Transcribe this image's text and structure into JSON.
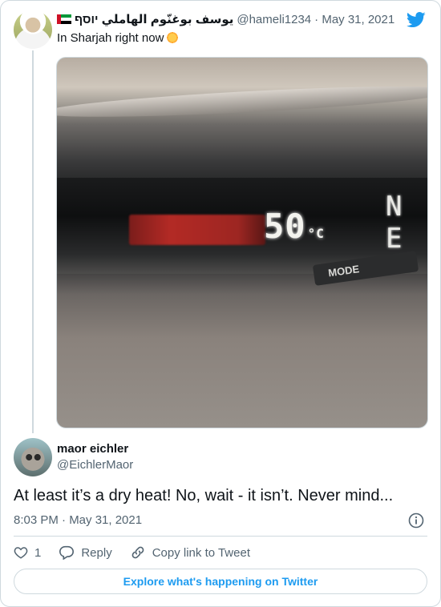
{
  "parent_tweet": {
    "display_name": "يوسف بوغنّوم الهاملي יוסף",
    "handle": "@hameli1234",
    "date": "· May 31, 2021",
    "text": "In Sharjah right now",
    "photo": {
      "temperature": "50",
      "unit": "°C",
      "compass": "N E",
      "mode_label": "MODE"
    }
  },
  "reply_tweet": {
    "display_name": "maor eichler",
    "handle": "@EichlerMaor",
    "text": "At least it’s a dry heat! No, wait - it isn’t. Never mind...",
    "timestamp": "8:03 PM · May 31, 2021"
  },
  "actions": {
    "like_count": "1",
    "reply_label": "Reply",
    "copy_label": "Copy link to Tweet"
  },
  "explore_label": "Explore what's happening on Twitter",
  "colors": {
    "accent": "#1d9bf0",
    "muted": "#536471",
    "border": "#cfd9de"
  },
  "icons": [
    "twitter-logo-icon",
    "sun-emoji-icon",
    "uae-flag-icon",
    "info-icon",
    "heart-icon",
    "reply-icon",
    "link-icon"
  ]
}
